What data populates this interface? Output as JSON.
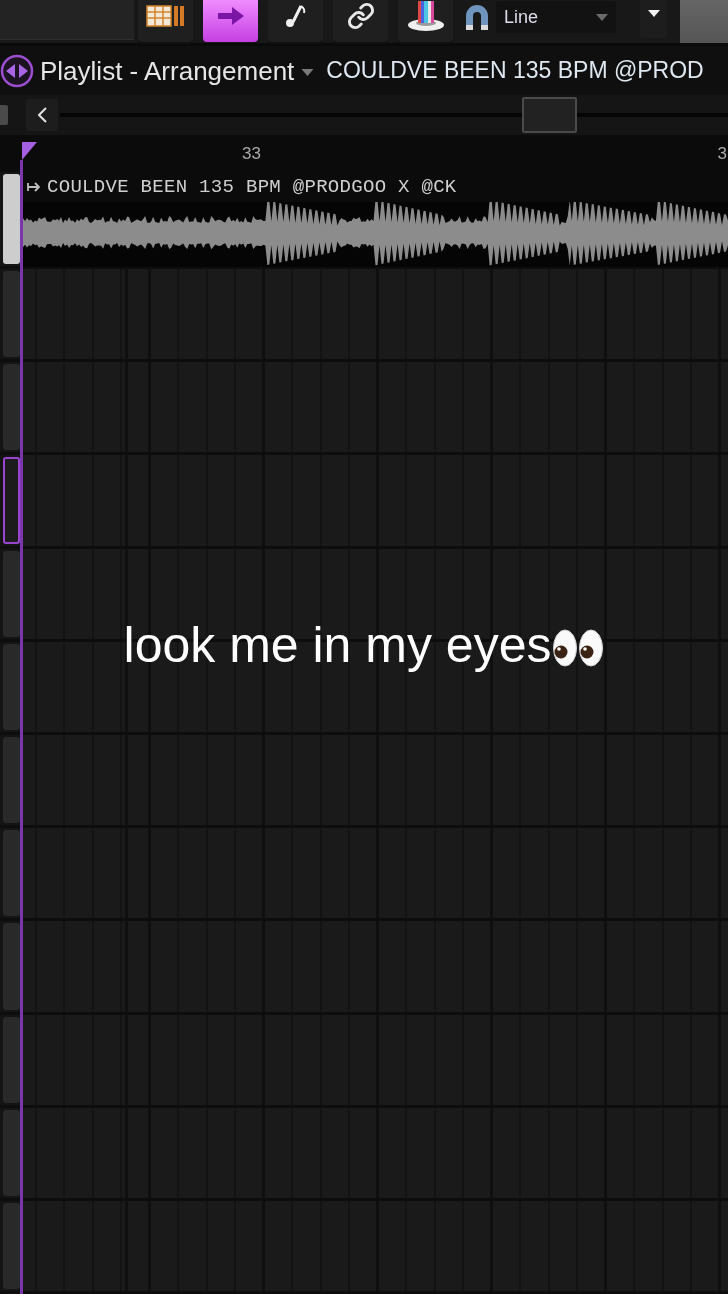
{
  "toolbar": {
    "tools": [
      {
        "selected": false
      },
      {
        "selected": true
      },
      {
        "selected": false
      },
      {
        "selected": false
      },
      {
        "selected": false
      }
    ],
    "snap": {
      "value": "Line"
    }
  },
  "title_bar": {
    "title": "Playlist - Arrangement",
    "pattern": "COULDVE BEEN 135 BPM @PROD"
  },
  "ruler": {
    "labels": [
      "33",
      "3"
    ]
  },
  "tracks": [
    {
      "selected": false,
      "clip": {
        "name": "COULDVE BEEN 135 BPM @PRODGOO X @CK"
      }
    },
    {
      "selected": false
    },
    {
      "selected": false
    },
    {
      "selected": true
    },
    {
      "selected": false
    },
    {
      "selected": false
    },
    {
      "selected": false
    },
    {
      "selected": false
    },
    {
      "selected": false
    },
    {
      "selected": false
    },
    {
      "selected": false
    },
    {
      "selected": false
    }
  ],
  "caption": {
    "text": "look me in my eyes"
  }
}
